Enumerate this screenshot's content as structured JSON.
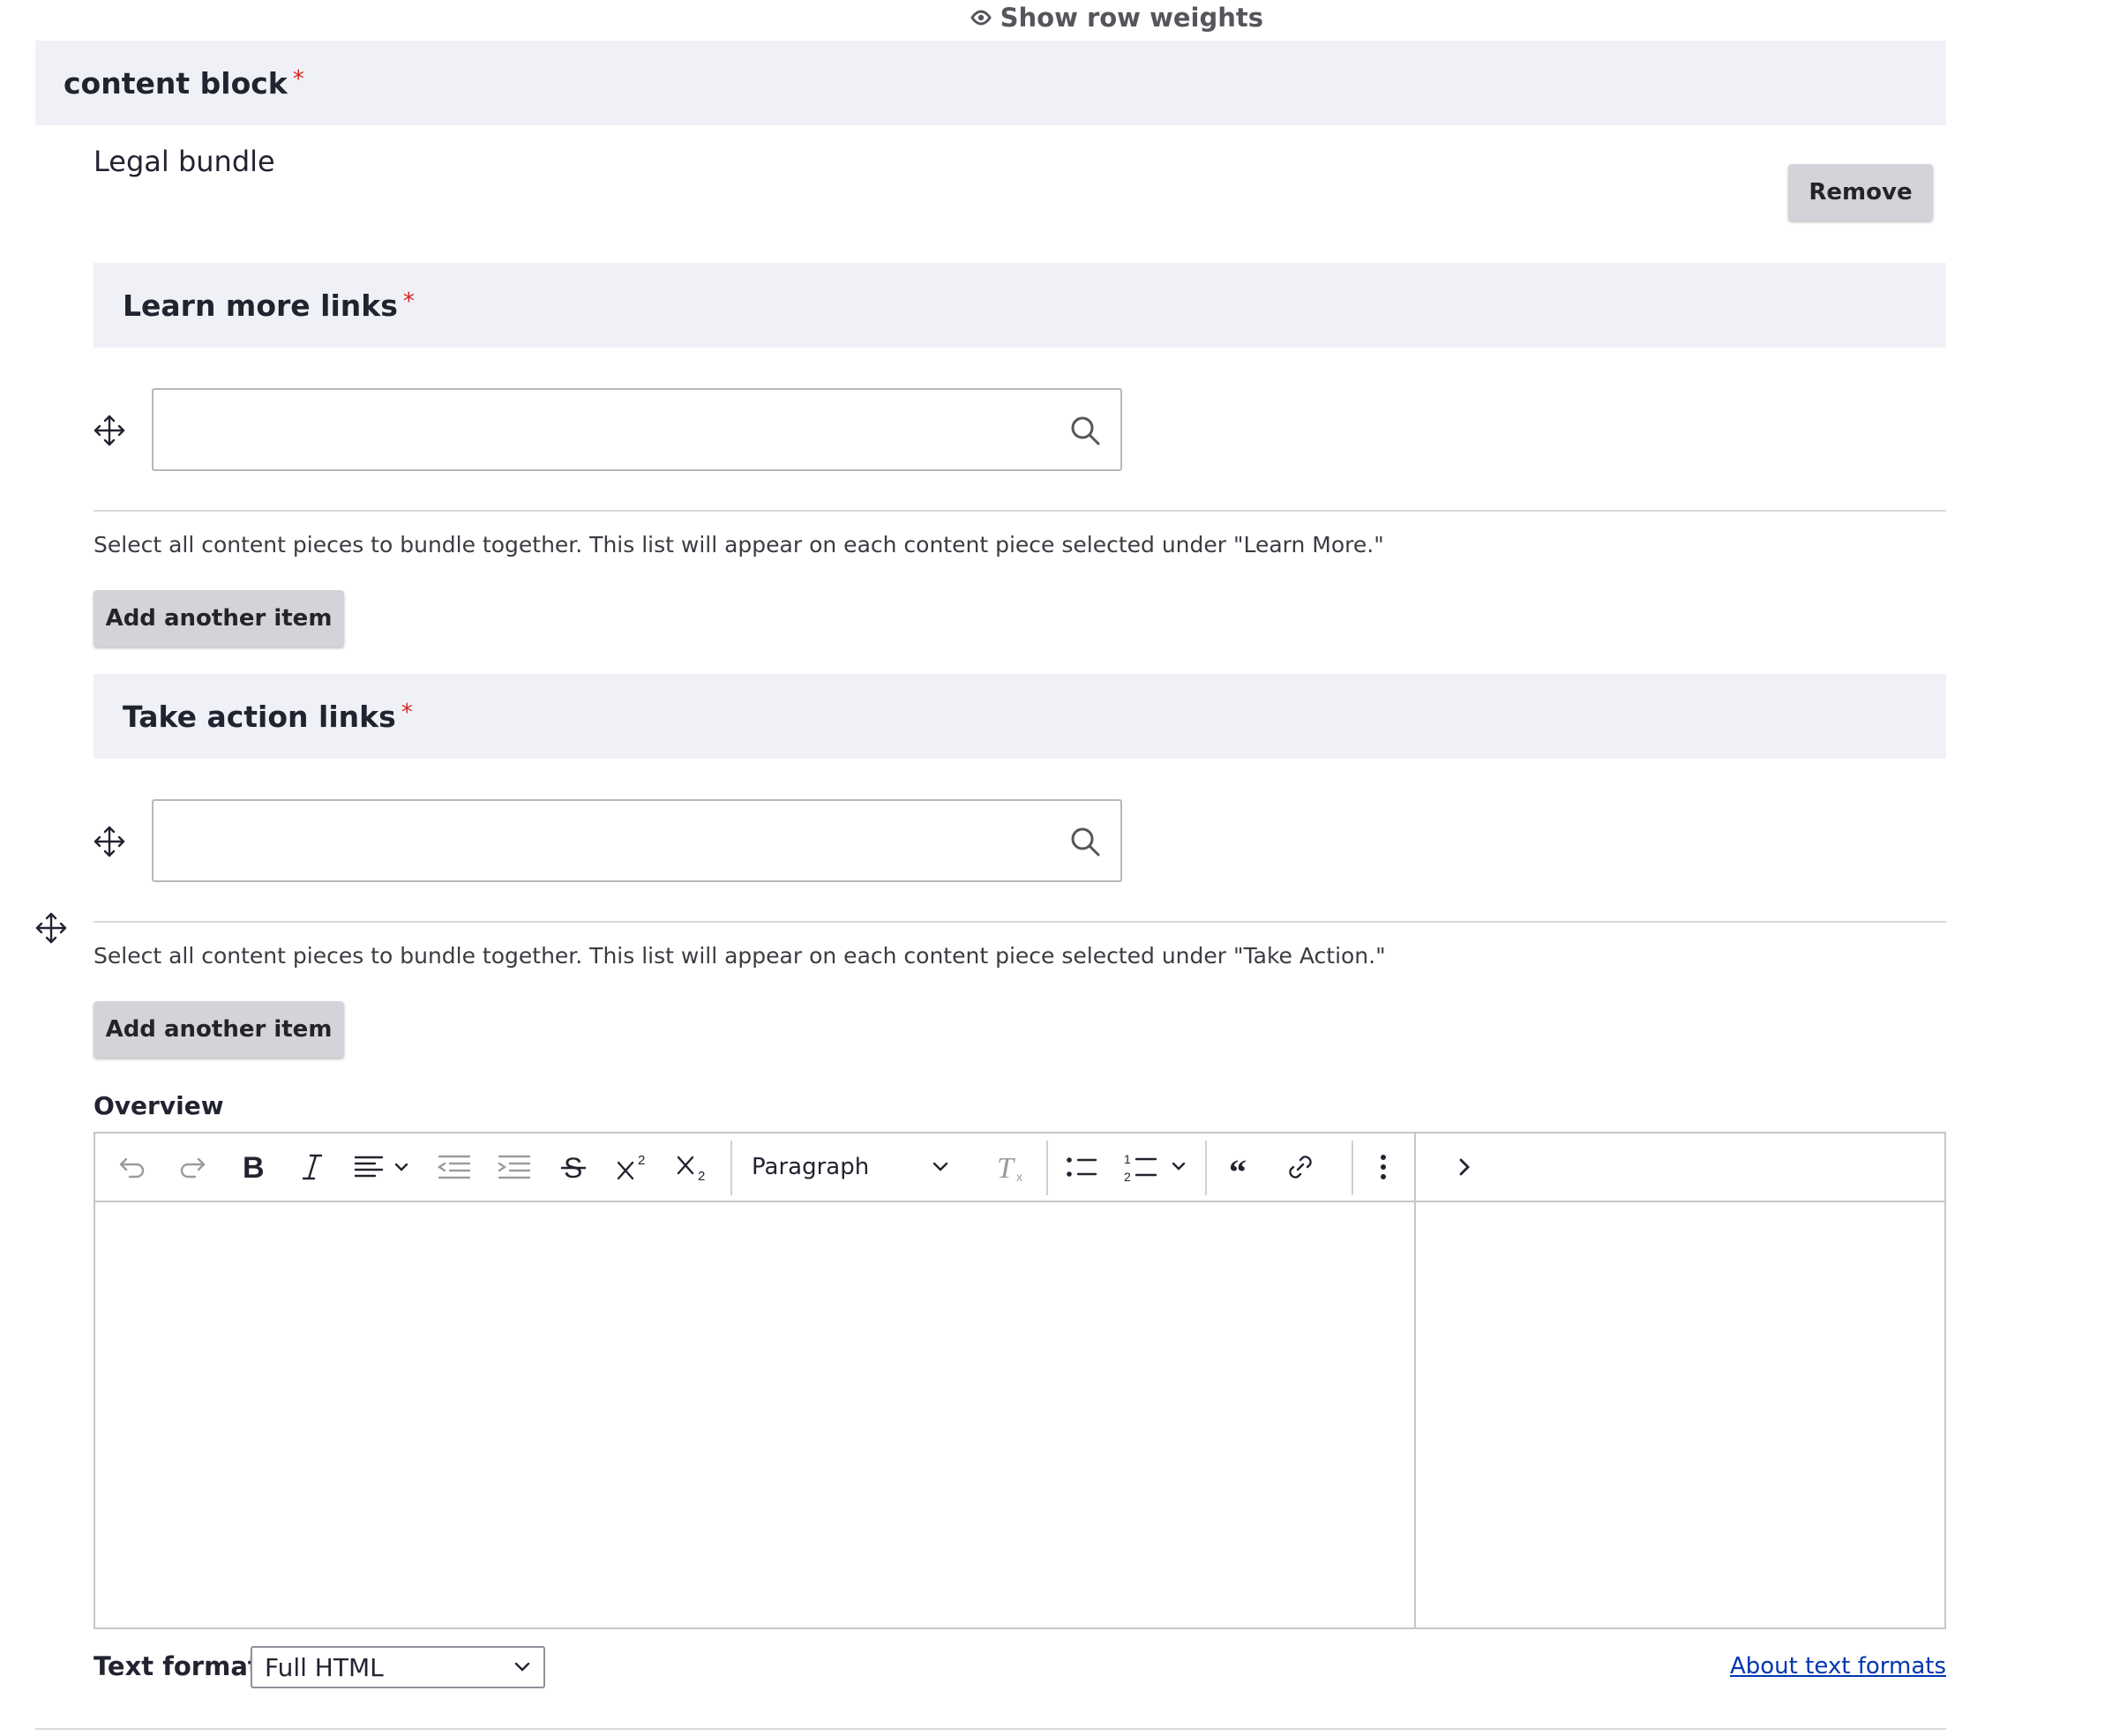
{
  "header": {
    "show_row_weights": "Show row weights"
  },
  "content_block": {
    "title": "content block",
    "required_marker": "*",
    "bundle_name": "Legal bundle",
    "remove_label": "Remove"
  },
  "learn_more": {
    "title": "Learn more links",
    "required_marker": "*",
    "input_value": "",
    "description": "Select all content pieces to bundle together. This list will appear on each content piece selected under \"Learn More.\"",
    "add_label": "Add another item"
  },
  "take_action": {
    "title": "Take action links",
    "required_marker": "*",
    "input_value": "",
    "description": "Select all content pieces to bundle together. This list will appear on each content piece selected under \"Take Action.\"",
    "add_label": "Add another item"
  },
  "overview": {
    "label": "Overview",
    "toolbar": {
      "heading_select": "Paragraph",
      "icons": [
        "undo-icon",
        "redo-icon",
        "bold-icon",
        "italic-icon",
        "align-icon",
        "outdent-icon",
        "indent-icon",
        "strikethrough-icon",
        "superscript-icon",
        "subscript-icon",
        "remove-format-icon",
        "bulleted-list-icon",
        "numbered-list-icon",
        "blockquote-icon",
        "link-icon",
        "more-vertical-icon",
        "chevron-right-icon"
      ]
    },
    "text_format_label": "Text format",
    "text_format_value": "Full HTML",
    "about_text_formats": "About text formats"
  },
  "colors": {
    "required": "#d72222",
    "link": "#0036b1",
    "header_bg": "#f0f1f6",
    "button_bg": "#d3d4d9"
  }
}
